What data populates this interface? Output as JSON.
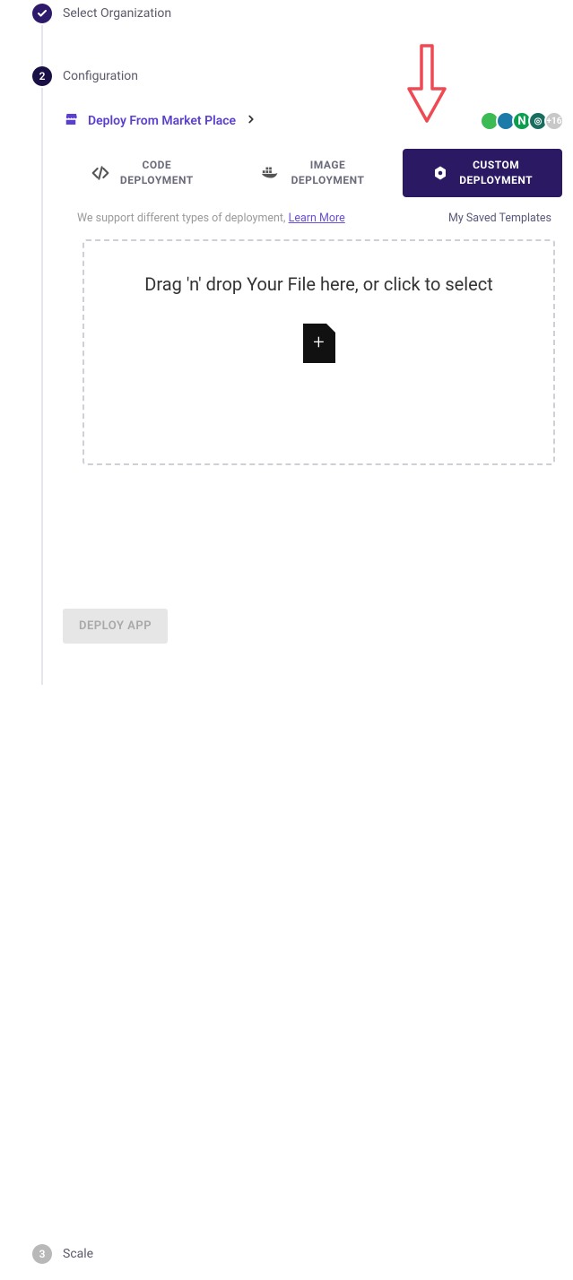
{
  "steps": {
    "s1": {
      "label": "Select Organization"
    },
    "s2": {
      "label": "Configuration"
    },
    "s3": {
      "num": "3",
      "label": "Scale"
    }
  },
  "market": {
    "label": "Deploy From Market Place"
  },
  "tech_more": "+16",
  "tabs": {
    "code": {
      "line1": "CODE",
      "line2": "DEPLOYMENT"
    },
    "image": {
      "line1": "IMAGE",
      "line2": "DEPLOYMENT"
    },
    "custom": {
      "line1": "CUSTOM",
      "line2": "DEPLOYMENT"
    }
  },
  "support": {
    "text": "We support different types of deployment, ",
    "learn": "Learn More"
  },
  "saved_templates": "My Saved Templates",
  "dropzone": {
    "text": "Drag 'n' drop Your File here, or click to select"
  },
  "deploy_button": "DEPLOY APP",
  "step2_num": "2"
}
